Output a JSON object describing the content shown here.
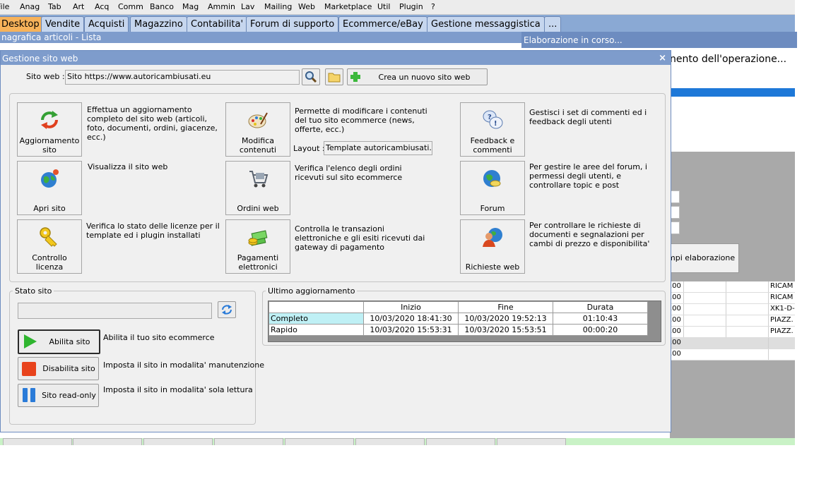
{
  "menu": [
    "File",
    "Anag",
    "Tab",
    "Art",
    "Acq",
    "Comm",
    "Banco",
    "Mag",
    "Ammin",
    "Lav",
    "Mailing",
    "Web",
    "Marketplace",
    "Util",
    "Plugin",
    "?"
  ],
  "tabs": [
    "Desktop",
    "Vendite",
    "Acquisti",
    "Magazzino",
    "Contabilita'",
    "Forum di supporto",
    "Ecommerce/eBay",
    "Gestione messaggistica",
    "..."
  ],
  "background": {
    "list_title": "nagrafica articoli  - Lista",
    "process_title": "Elaborazione in corso...",
    "process_text": "nento dell'operazione...",
    "process_button": "mpi elaborazione",
    "rows": [
      {
        "value": ",00",
        "text": "RICAM"
      },
      {
        "value": ",00",
        "text": "RICAM"
      },
      {
        "value": ",00",
        "text": "XK1-D-"
      },
      {
        "value": ",00",
        "text": "PIAZZ."
      },
      {
        "value": ",00",
        "text": "PIAZZ."
      },
      {
        "value": ",00",
        "text": ""
      },
      {
        "value": ",00",
        "text": ""
      }
    ]
  },
  "dialog": {
    "title": "Gestione sito web",
    "close": "×",
    "site_label": "Sito web :",
    "site_value": "Sito https://www.autoricambiusati.eu",
    "create_site": "Crea un nuovo sito web",
    "layout_label": "Layout :",
    "layout_value": "Template autoricambiusati.eu",
    "tools": [
      {
        "caption": "Aggiornamento sito",
        "desc": "Effettua un aggiornamento completo del sito web (articoli, foto, documenti, ordini, giacenze, ecc.)",
        "icon": "refresh-icon"
      },
      {
        "caption": "Modifica contenuti",
        "desc": "Permette di modificare i contenuti del tuo sito ecommerce (news, offerte, ecc.)",
        "icon": "palette-icon"
      },
      {
        "caption": "Feedback e commenti",
        "desc": "Gestisci i set di commenti ed i feedback degli utenti",
        "icon": "feedback-icon"
      },
      {
        "caption": "Apri sito",
        "desc": "Visualizza il sito web",
        "icon": "globe-icon"
      },
      {
        "caption": "Ordini web",
        "desc": "Verifica l'elenco degli ordini ricevuti sul sito ecommerce",
        "icon": "cart-icon"
      },
      {
        "caption": "Forum",
        "desc": "Per gestire le aree del forum, i permessi degli utenti, e controllare topic e post",
        "icon": "forum-icon"
      },
      {
        "caption": "Controllo licenza",
        "desc": "Verifica lo stato delle licenze per il template ed i plugin installati",
        "icon": "key-icon"
      },
      {
        "caption": "Pagamenti elettronici",
        "desc": "Controlla le transazioni elettroniche e gli esiti ricevuti dai gateway di pagamento",
        "icon": "money-icon"
      },
      {
        "caption": "Richieste web",
        "desc": "Per controllare le richieste di documenti e segnalazioni per cambi di prezzo e disponibilita'",
        "icon": "user-globe-icon"
      }
    ],
    "state": {
      "title": "Stato sito",
      "status_value": "",
      "buttons": [
        {
          "label": "Abilita sito",
          "desc": "Abilita il tuo sito ecommerce",
          "color": "#2fb52f"
        },
        {
          "label": "Disabilita sito",
          "desc": "Imposta il sito in modalita' manutenzione",
          "color": "#e8431c"
        },
        {
          "label": "Sito read-only",
          "desc": "Imposta il sito in modalita' sola lettura",
          "color": "#2a7bd8"
        }
      ]
    },
    "last_update": {
      "title": "Ultimo aggiornamento",
      "headers": [
        "",
        "Inizio",
        "Fine",
        "Durata"
      ],
      "rows": [
        [
          "Completo",
          "10/03/2020 18:41:30",
          "10/03/2020 19:52:13",
          "01:10:43"
        ],
        [
          "Rapido",
          "10/03/2020 15:53:31",
          "10/03/2020 15:53:51",
          "00:00:20"
        ]
      ]
    }
  }
}
